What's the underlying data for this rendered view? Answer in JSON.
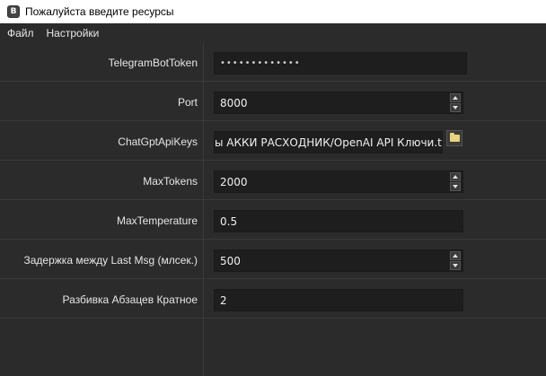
{
  "window": {
    "icon": "app-b-icon",
    "icon_glyph": "B",
    "title": "Пожалуйста введите ресурсы"
  },
  "menu": {
    "file": "Файл",
    "settings": "Настройки"
  },
  "fields": {
    "telegram_bot_token": {
      "label": "TelegramBotToken",
      "value": "•••••••••••••"
    },
    "port": {
      "label": "Port",
      "value": "8000"
    },
    "chatgpt_api_keys": {
      "label": "ChatGptApiKeys",
      "value": "ы АККИ РАСХОДНИК/OpenAI API Ключи.txt",
      "browse_icon": "folder-icon"
    },
    "max_tokens": {
      "label": "MaxTokens",
      "value": "2000"
    },
    "max_temperature": {
      "label": "MaxTemperature",
      "value": "0.5"
    },
    "msg_delay": {
      "label": "Задержка между Last Msg (млсек.)",
      "value": "500"
    },
    "paragraph_split": {
      "label": "Разбивка Абзацев Кратное",
      "value": "2"
    }
  },
  "colors": {
    "background": "#2b2b2b",
    "field_bg": "#1e1e1e",
    "titlebar_bg": "#ffffff",
    "text": "#e6e6e6"
  }
}
